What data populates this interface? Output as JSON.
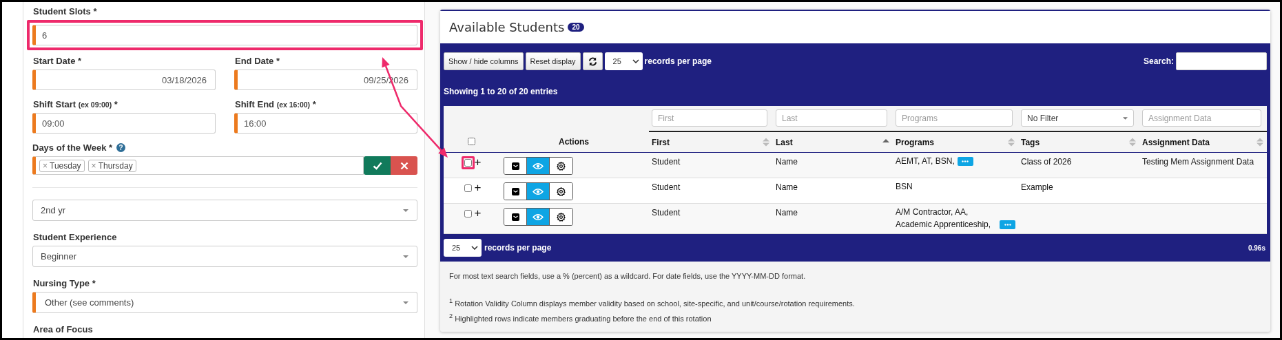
{
  "form": {
    "items": [
      {
        "kind": "single",
        "label": "Student Slots *",
        "value": "6",
        "required": true,
        "highlighted": true
      },
      {
        "kind": "pair",
        "fields": [
          {
            "kind": "date",
            "label": "Start Date *",
            "value": "03/18/2026",
            "required": true
          },
          {
            "kind": "date",
            "label": "End Date *",
            "value": "09/25/2026",
            "required": true
          }
        ]
      },
      {
        "kind": "pair",
        "fields": [
          {
            "label": "Shift Start",
            "hint": "(ex 09:00)",
            "mark": "*",
            "value": "09:00",
            "kind": "time",
            "required": true
          },
          {
            "label": "Shift End",
            "hint": "(ex 16:00)",
            "mark": "*",
            "value": "16:00",
            "kind": "time",
            "required": true
          }
        ]
      },
      {
        "kind": "tags",
        "label": "Days of the Week *",
        "help": "?",
        "required": true,
        "tags": [
          {
            "remove": "×",
            "label": "Tuesday"
          },
          {
            "remove": "×",
            "label": "Thursday"
          }
        ]
      },
      {
        "kind": "divider"
      },
      {
        "kind": "select",
        "value": "2nd yr",
        "required": false
      },
      {
        "kind": "select",
        "label": "Student Experience",
        "value": "Beginner",
        "required": false
      },
      {
        "kind": "select",
        "label": "Nursing Type *",
        "value": "Other (see comments)",
        "required": true
      },
      {
        "kind": "heading",
        "label": "Area of Focus"
      }
    ]
  },
  "panel": {
    "title": "Available Students",
    "count": "20",
    "toolbar": {
      "buttons": [
        "Show / hide columns",
        "Reset display"
      ],
      "page_size": "25",
      "per_page_label": "records per page",
      "search_label": "Search:"
    },
    "info": "Showing 1 to 20 of 20 entries",
    "table": {
      "filters": [
        {
          "kind": "text",
          "placeholder": "First"
        },
        {
          "kind": "text",
          "placeholder": "Last"
        },
        {
          "kind": "text",
          "placeholder": "Programs"
        },
        {
          "kind": "select",
          "value": "No Filter"
        },
        {
          "kind": "text",
          "placeholder": "Assignment Data"
        }
      ],
      "columns": [
        {
          "kind": "select_all",
          "checked": false
        },
        {
          "kind": "plain",
          "label": "Actions"
        },
        {
          "kind": "sortable",
          "label": "First",
          "sorted_ascending": false
        },
        {
          "kind": "sortable",
          "label": "Last",
          "sorted_ascending": true
        },
        {
          "kind": "sortable",
          "label": "Programs",
          "sorted_ascending": false
        },
        {
          "kind": "sortable",
          "label": "Tags",
          "sorted_ascending": false
        },
        {
          "kind": "sortable",
          "label": "Assignment Data",
          "sorted_ascending": false
        }
      ],
      "rows": [
        {
          "checked": false,
          "highlighted": true,
          "expand": "+",
          "first": "Student",
          "last": "Name",
          "programs": "AEMT, AT, BSN,",
          "more": true,
          "tags": "Class of 2026",
          "assignment_data": "Testing Mem Assignment Data"
        },
        {
          "checked": false,
          "highlighted": false,
          "expand": "+",
          "first": "Student",
          "last": "Name",
          "programs": "BSN",
          "tags": "Example"
        },
        {
          "checked": false,
          "highlighted": false,
          "expand": "+",
          "first": "Student",
          "last": "Name",
          "programs": "A/M Contractor, AA, Academic Apprenticeship,",
          "more": true
        }
      ]
    },
    "footer": {
      "page_size": "25",
      "per_page_label": "records per page",
      "timing": "0.96s"
    },
    "notes": [
      "For most text search fields, use a % (percent) as a wildcard. For date fields, use the YYYY-MM-DD format.",
      "$^{1}$ Rotation Validity Column displays member validity based on school, site-specific, and unit/course/rotation requirements.",
      "$^{2}$ Highlighted rows indicate members graduating before the end of this rotation"
    ]
  }
}
